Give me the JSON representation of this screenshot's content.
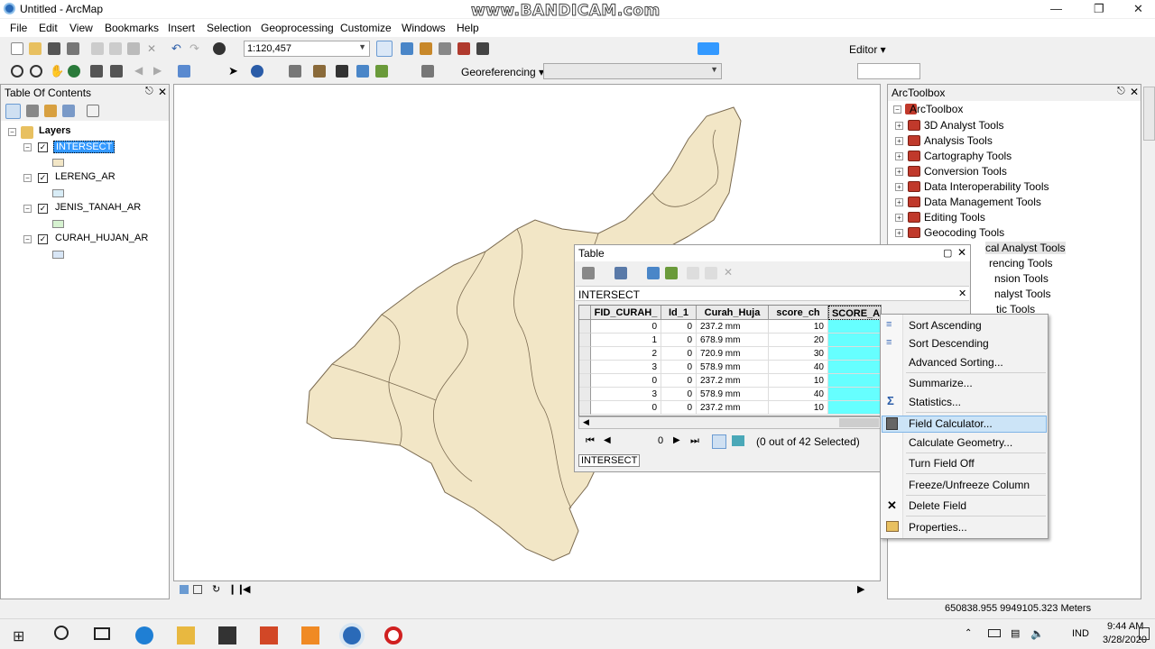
{
  "window": {
    "title": "Untitled - ArcMap",
    "watermark": "www.BANDICAM.com"
  },
  "menu": [
    "File",
    "Edit",
    "View",
    "Bookmarks",
    "Insert",
    "Selection",
    "Geoprocessing",
    "Customize",
    "Windows",
    "Help"
  ],
  "toolbar": {
    "scale": "1:120,457",
    "editor_label": "Editor ▾",
    "georef_label": "Georeferencing ▾"
  },
  "toc": {
    "title": "Table Of Contents",
    "root": "Layers",
    "layers": [
      {
        "name": "INTERSECT",
        "swatch": "#f2e6c6",
        "selected": true
      },
      {
        "name": "LERENG_AR",
        "swatch": "#d8ecf6",
        "selected": false
      },
      {
        "name": "JENIS_TANAH_AR",
        "swatch": "#d6f2d0",
        "selected": false
      },
      {
        "name": "CURAH_HUJAN_AR",
        "swatch": "#d8e6f6",
        "selected": false
      }
    ]
  },
  "toolbox": {
    "title": "ArcToolbox",
    "root": "ArcToolbox",
    "items": [
      "3D Analyst Tools",
      "Analysis Tools",
      "Cartography Tools",
      "Conversion Tools",
      "Data Interoperability Tools",
      "Data Management Tools",
      "Editing Tools",
      "Geocoding Tools",
      "cal Analyst Tools",
      "rencing Tools",
      "nsion Tools",
      "nalyst Tools",
      "tic Tools"
    ]
  },
  "table": {
    "title": "Table",
    "layer": "INTERSECT",
    "columns": [
      "FID_CURAH_",
      "Id_1",
      "Curah_Huja",
      "score_ch",
      "SCORE_AKHI"
    ],
    "rows": [
      [
        "0",
        "0",
        "237.2  mm",
        "10",
        ""
      ],
      [
        "1",
        "0",
        "678.9  mm",
        "20",
        ""
      ],
      [
        "2",
        "0",
        "720.9  mm",
        "30",
        ""
      ],
      [
        "3",
        "0",
        "578.9  mm",
        "40",
        ""
      ],
      [
        "0",
        "0",
        "237.2  mm",
        "10",
        ""
      ],
      [
        "3",
        "0",
        "578.9  mm",
        "40",
        ""
      ],
      [
        "0",
        "0",
        "237.2  mm",
        "10",
        ""
      ]
    ],
    "record": "0",
    "selection": "(0 out of 42 Selected)",
    "tab": "INTERSECT"
  },
  "context_menu": [
    {
      "label": "Sort Ascending",
      "icon": "sort-ascending-icon"
    },
    {
      "label": "Sort Descending",
      "icon": "sort-descending-icon"
    },
    {
      "label": "Advanced Sorting...",
      "icon": ""
    },
    {
      "label": "Summarize...",
      "icon": ""
    },
    {
      "label": "Statistics...",
      "icon": "sigma-icon"
    },
    {
      "label": "Field Calculator...",
      "icon": "calculator-icon",
      "highlighted": true
    },
    {
      "label": "Calculate Geometry...",
      "icon": ""
    },
    {
      "label": "Turn Field Off",
      "icon": ""
    },
    {
      "label": "Freeze/Unfreeze Column",
      "icon": ""
    },
    {
      "label": "Delete Field",
      "icon": "close-icon"
    },
    {
      "label": "Properties...",
      "icon": "properties-icon"
    }
  ],
  "status": {
    "coords": "650838.955  9949105.323 Meters"
  },
  "taskbar": {
    "time": "9:44 AM",
    "date": "3/28/2020",
    "lang": "IND"
  },
  "colors": {
    "map_fill": "#f2e6c6",
    "selection_blue": "#3399ff",
    "highlight": "#cce4f7",
    "cyan_col": "#66ffff"
  }
}
